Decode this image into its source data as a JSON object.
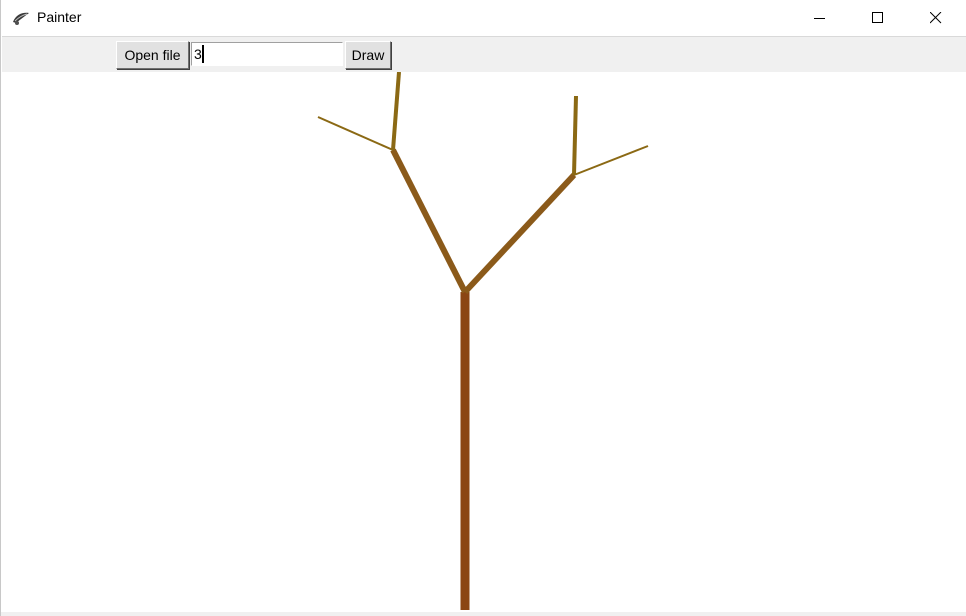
{
  "window": {
    "title": "Painter",
    "icon": "feather-tk-icon",
    "controls": [
      "minimize-icon",
      "maximize-icon",
      "close-icon"
    ]
  },
  "toolbar": {
    "open_file_label": "Open file",
    "depth_value": "3",
    "draw_label": "Draw"
  },
  "drawing": {
    "description_colors": {
      "trunk": "#8b4513",
      "level2": "#8b5a1a",
      "level3": "#8b6914"
    }
  }
}
